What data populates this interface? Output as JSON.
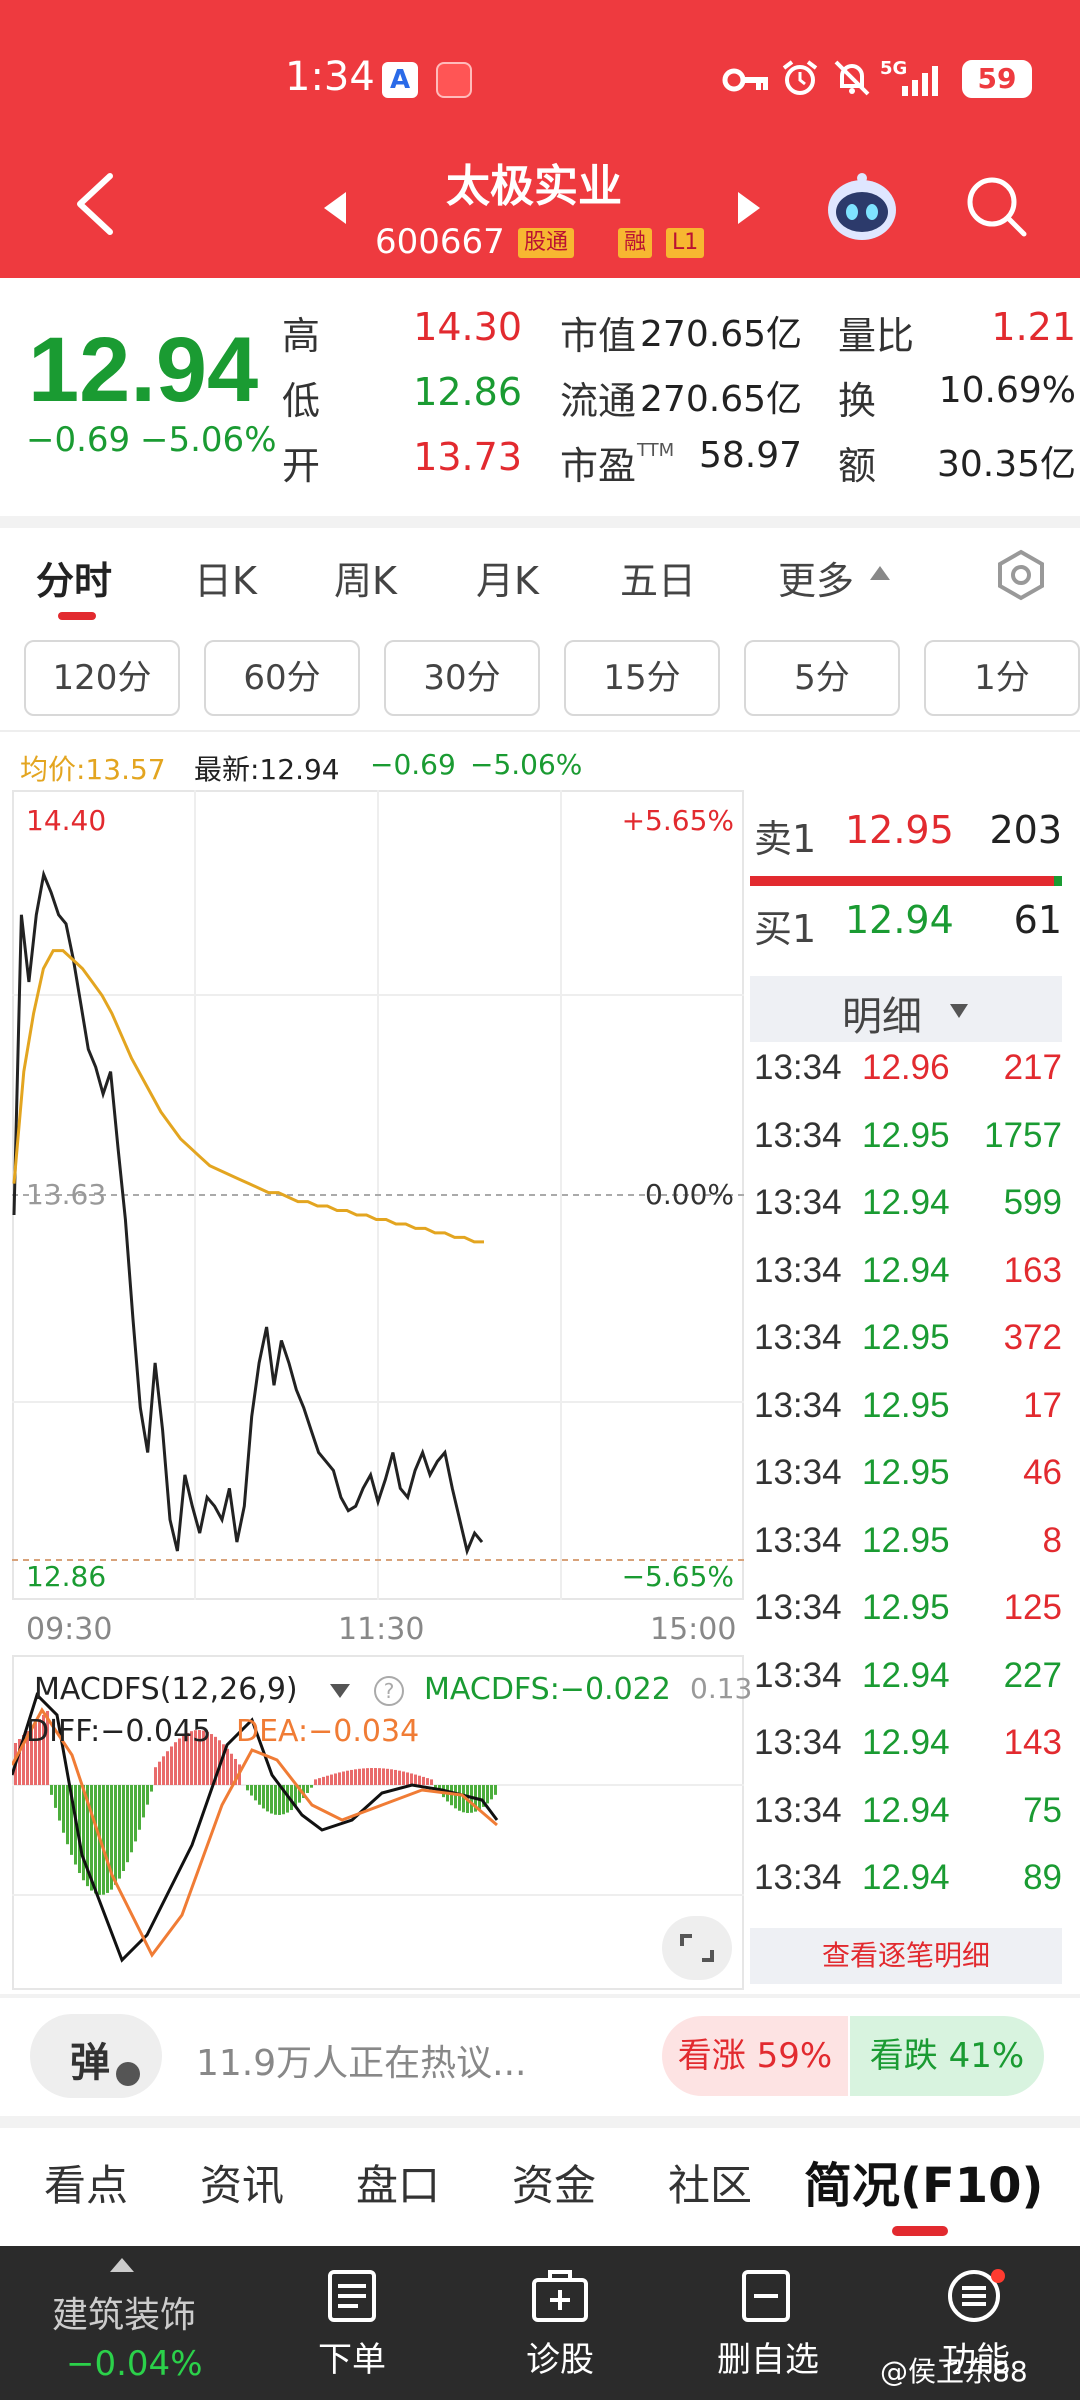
{
  "status_bar": {
    "time": "1:34",
    "app_badge": "A",
    "network": "5G",
    "battery": "59"
  },
  "nav": {
    "title": "太极实业",
    "code": "600667",
    "tag_hk": "股通",
    "tag_margin": "融",
    "tag_level": "L1"
  },
  "quote": {
    "price": "12.94",
    "change": "−0.69",
    "change_pct": "−5.06%",
    "high_label": "高",
    "high": "14.30",
    "low_label": "低",
    "low": "12.86",
    "open_label": "开",
    "open": "13.73",
    "mktcap_label": "市值",
    "mktcap": "270.65亿",
    "float_label": "流通",
    "float": "270.65亿",
    "pe_label": "市盈",
    "pe_sup": "TTM",
    "pe": "58.97",
    "vol_ratio_label": "量比",
    "vol_ratio": "1.21",
    "turnover_label": "换",
    "turnover": "10.69%",
    "amount_label": "额",
    "amount": "30.35亿"
  },
  "period_tabs": [
    "分时",
    "日K",
    "周K",
    "月K",
    "五日",
    "更多"
  ],
  "minute_tabs": [
    "120分",
    "60分",
    "30分",
    "15分",
    "5分",
    "1分"
  ],
  "info_line": {
    "avg": "均价:13.57",
    "latest": "最新:12.94",
    "chg": "−0.69",
    "pct": "−5.06%"
  },
  "chart_data": [
    {
      "type": "line",
      "x_labels": [
        "09:30",
        "11:30",
        "15:00"
      ],
      "ylim": [
        12.86,
        14.4
      ],
      "y_labels": {
        "top": "14.40",
        "mid": "13.63",
        "bottom": "12.86"
      },
      "right_labels": {
        "top": "+5.65%",
        "mid": "0.00%",
        "bottom": "−5.65%"
      },
      "series": [
        {
          "values": [
            13.63,
            14.3,
            14.15,
            14.3,
            14.39,
            14.35,
            14.3,
            14.28,
            14.2,
            14.1,
            14.0,
            13.96,
            13.9,
            13.95,
            13.78,
            13.62,
            13.4,
            13.2,
            13.1,
            13.3,
            13.15,
            12.95,
            12.88,
            13.05,
            12.98,
            12.92,
            13.0,
            12.98,
            12.95,
            13.02,
            12.9,
            12.98,
            13.18,
            13.3,
            13.38,
            13.25,
            13.35,
            13.3,
            13.24,
            13.2,
            13.15,
            13.1,
            13.08,
            13.06,
            13.0,
            12.97,
            12.98,
            13.02,
            13.05,
            12.99,
            13.04,
            13.1,
            13.02,
            13.0,
            13.06,
            13.1,
            13.05,
            13.08,
            13.1,
            13.02,
            12.95,
            12.88,
            12.92,
            12.9
          ]
        },
        {
          "values": [
            13.7,
            13.95,
            14.08,
            14.18,
            14.22,
            14.22,
            14.2,
            14.18,
            14.15,
            14.12,
            14.08,
            14.03,
            13.98,
            13.94,
            13.9,
            13.86,
            13.83,
            13.8,
            13.78,
            13.76,
            13.74,
            13.73,
            13.72,
            13.71,
            13.7,
            13.69,
            13.68,
            13.68,
            13.67,
            13.66,
            13.66,
            13.65,
            13.65,
            13.64,
            13.64,
            13.63,
            13.63,
            13.62,
            13.62,
            13.61,
            13.61,
            13.6,
            13.6,
            13.59,
            13.59,
            13.58,
            13.58,
            13.57,
            13.57
          ]
        }
      ]
    },
    {
      "type": "bar",
      "title": "MACDFS(12,26,9)",
      "value_label": "MACDFS:−0.022",
      "diff_label": "DIFF:−0.045",
      "dea_label": "DEA:−0.034",
      "right_top": "0.13"
    }
  ],
  "order_book": {
    "sell1": {
      "label": "卖1",
      "price": "12.95",
      "vol": "203"
    },
    "buy1": {
      "label": "买1",
      "price": "12.94",
      "vol": "61"
    },
    "detail_title": "明细",
    "ticks": [
      {
        "time": "13:34",
        "price": "12.96",
        "vol": "217",
        "dir": "red"
      },
      {
        "time": "13:34",
        "price": "12.95",
        "vol": "1757",
        "dir": "green"
      },
      {
        "time": "13:34",
        "price": "12.94",
        "vol": "599",
        "dir": "green"
      },
      {
        "time": "13:34",
        "price": "12.94",
        "vol": "163",
        "dir": "red"
      },
      {
        "time": "13:34",
        "price": "12.95",
        "vol": "372",
        "dir": "red"
      },
      {
        "time": "13:34",
        "price": "12.95",
        "vol": "17",
        "dir": "red"
      },
      {
        "time": "13:34",
        "price": "12.95",
        "vol": "46",
        "dir": "red"
      },
      {
        "time": "13:34",
        "price": "12.95",
        "vol": "8",
        "dir": "red"
      },
      {
        "time": "13:34",
        "price": "12.95",
        "vol": "125",
        "dir": "red"
      },
      {
        "time": "13:34",
        "price": "12.94",
        "vol": "227",
        "dir": "green"
      },
      {
        "time": "13:34",
        "price": "12.94",
        "vol": "143",
        "dir": "red"
      },
      {
        "time": "13:34",
        "price": "12.94",
        "vol": "75",
        "dir": "green"
      },
      {
        "time": "13:34",
        "price": "12.94",
        "vol": "89",
        "dir": "green"
      }
    ],
    "more_link": "查看逐笔明细"
  },
  "discuss": {
    "danmu": "弹",
    "text": "11.9万人正在热议...",
    "up": "看涨 59%",
    "down": "看跌 41%"
  },
  "bottom_tabs": [
    "看点",
    "资讯",
    "盘口",
    "资金",
    "社区",
    "简况(F10)"
  ],
  "bottom_nav": {
    "sector_name": "建筑装饰",
    "sector_change": "−0.04%",
    "order": "下单",
    "diagnose": "诊股",
    "remove": "删自选",
    "func": "功能"
  },
  "watermark": "@侯卫东88",
  "colors": {
    "header": "#ee3a3f",
    "up": "#e22a2f",
    "down": "#1a9b32",
    "avg_line": "#e3a520"
  }
}
